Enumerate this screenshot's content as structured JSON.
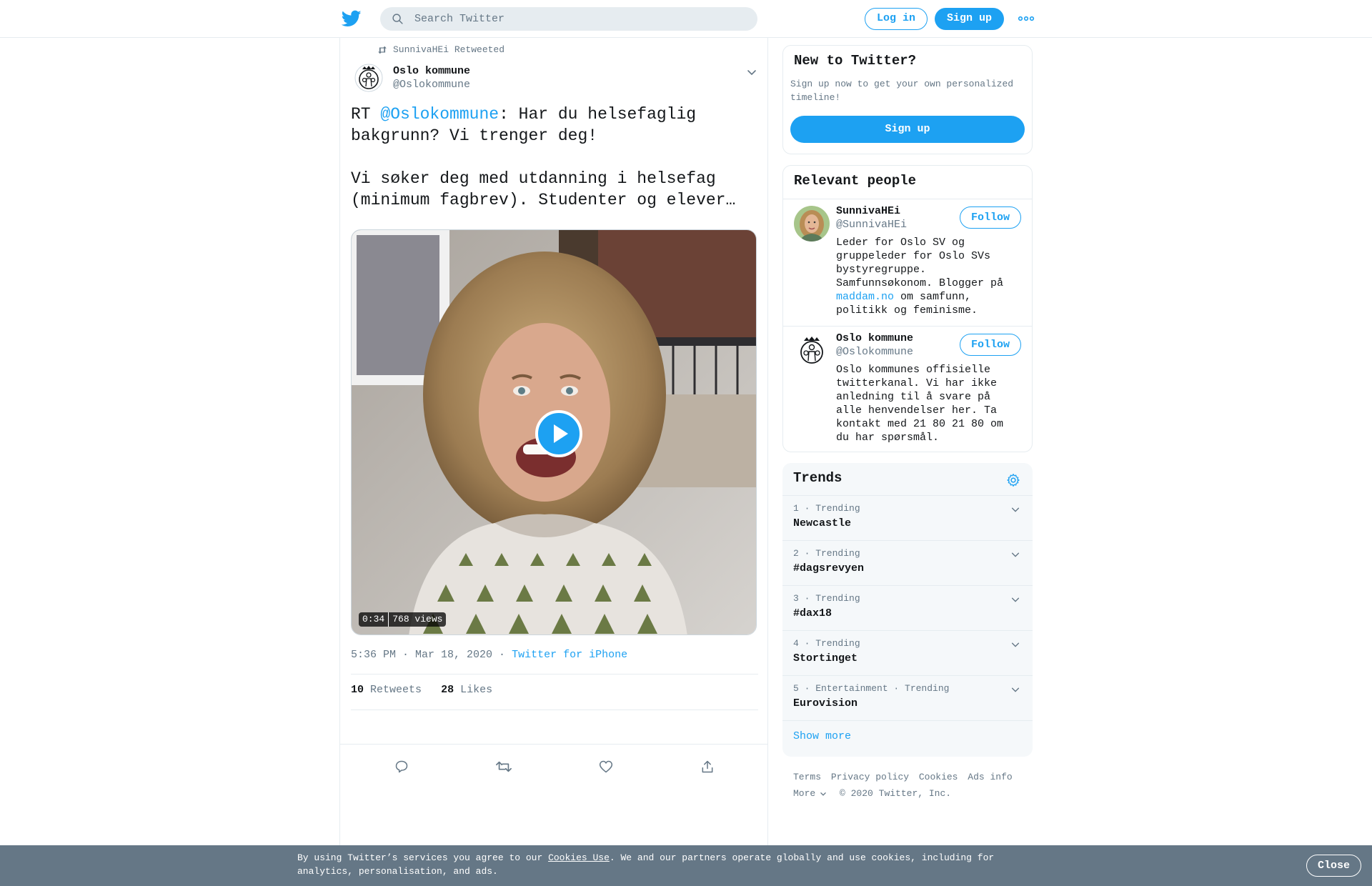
{
  "header": {
    "search_placeholder": "Search Twitter",
    "login_label": "Log in",
    "signup_label": "Sign up"
  },
  "tweet": {
    "retweeted_by": "SunnivaHEi Retweeted",
    "author_name": "Oslo kommune",
    "author_handle": "@Oslokommune",
    "text_prefix": "RT ",
    "text_mention": "@Oslokommune",
    "text_body": ": Har du helsefaglig bakgrunn? Vi trenger deg!\n\nVi søker deg med utdanning i helsefag (minimum fagbrev). Studenter og elever…",
    "video_duration": "0:34",
    "video_views": "768 views",
    "timestamp": "5:36 PM · Mar 18, 2020 ·",
    "source": "Twitter for iPhone",
    "retweets_count": "10",
    "retweets_label": "Retweets",
    "likes_count": "28",
    "likes_label": "Likes"
  },
  "sidebar": {
    "new_to_twitter": {
      "title": "New to Twitter?",
      "subtitle": "Sign up now to get your own personalized timeline!",
      "button": "Sign up"
    },
    "relevant_people": {
      "title": "Relevant people",
      "people": [
        {
          "name": "SunnivaHEi",
          "handle": "@SunnivaHEi",
          "bio_before": "Leder for Oslo SV og gruppeleder for Oslo SVs bystyregruppe. Samfunnsøkonom. Blogger på ",
          "bio_link": "maddam.no",
          "bio_after": " om samfunn, politikk og feminisme.",
          "follow": "Follow"
        },
        {
          "name": "Oslo kommune",
          "handle": "@Oslokommune",
          "bio": "Oslo kommunes offisielle twitterkanal. Vi har ikke anledning til å svare på alle henvendelser her. Ta kontakt med 21 80 21 80 om du har spørsmål.",
          "follow": "Follow"
        }
      ]
    },
    "trends": {
      "title": "Trends",
      "items": [
        {
          "meta": "1 · Trending",
          "name": "Newcastle"
        },
        {
          "meta": "2 · Trending",
          "name": "#dagsrevyen"
        },
        {
          "meta": "3 · Trending",
          "name": "#dax18"
        },
        {
          "meta": "4 · Trending",
          "name": "Stortinget"
        },
        {
          "meta": "5 · Entertainment · Trending",
          "name": "Eurovision"
        }
      ],
      "show_more": "Show more"
    },
    "footer": {
      "links": [
        "Terms",
        "Privacy policy",
        "Cookies",
        "Ads info"
      ],
      "more": "More",
      "copyright": "© 2020 Twitter, Inc."
    }
  },
  "cookie_bar": {
    "text_before": "By using Twitter’s services you agree to our ",
    "link": "Cookies Use",
    "text_after": ". We and our partners operate globally and use cookies, including for analytics, personalisation, and ads.",
    "close": "Close"
  },
  "colors": {
    "brand": "#1da1f2",
    "secondary_text": "#657786",
    "cookie_bg": "#657786"
  },
  "icons": [
    "twitter-bird-icon",
    "search-icon",
    "more-dots-icon",
    "retweet-icon",
    "chevron-down-icon",
    "play-icon",
    "reply-icon",
    "like-icon",
    "share-icon",
    "gear-icon"
  ]
}
